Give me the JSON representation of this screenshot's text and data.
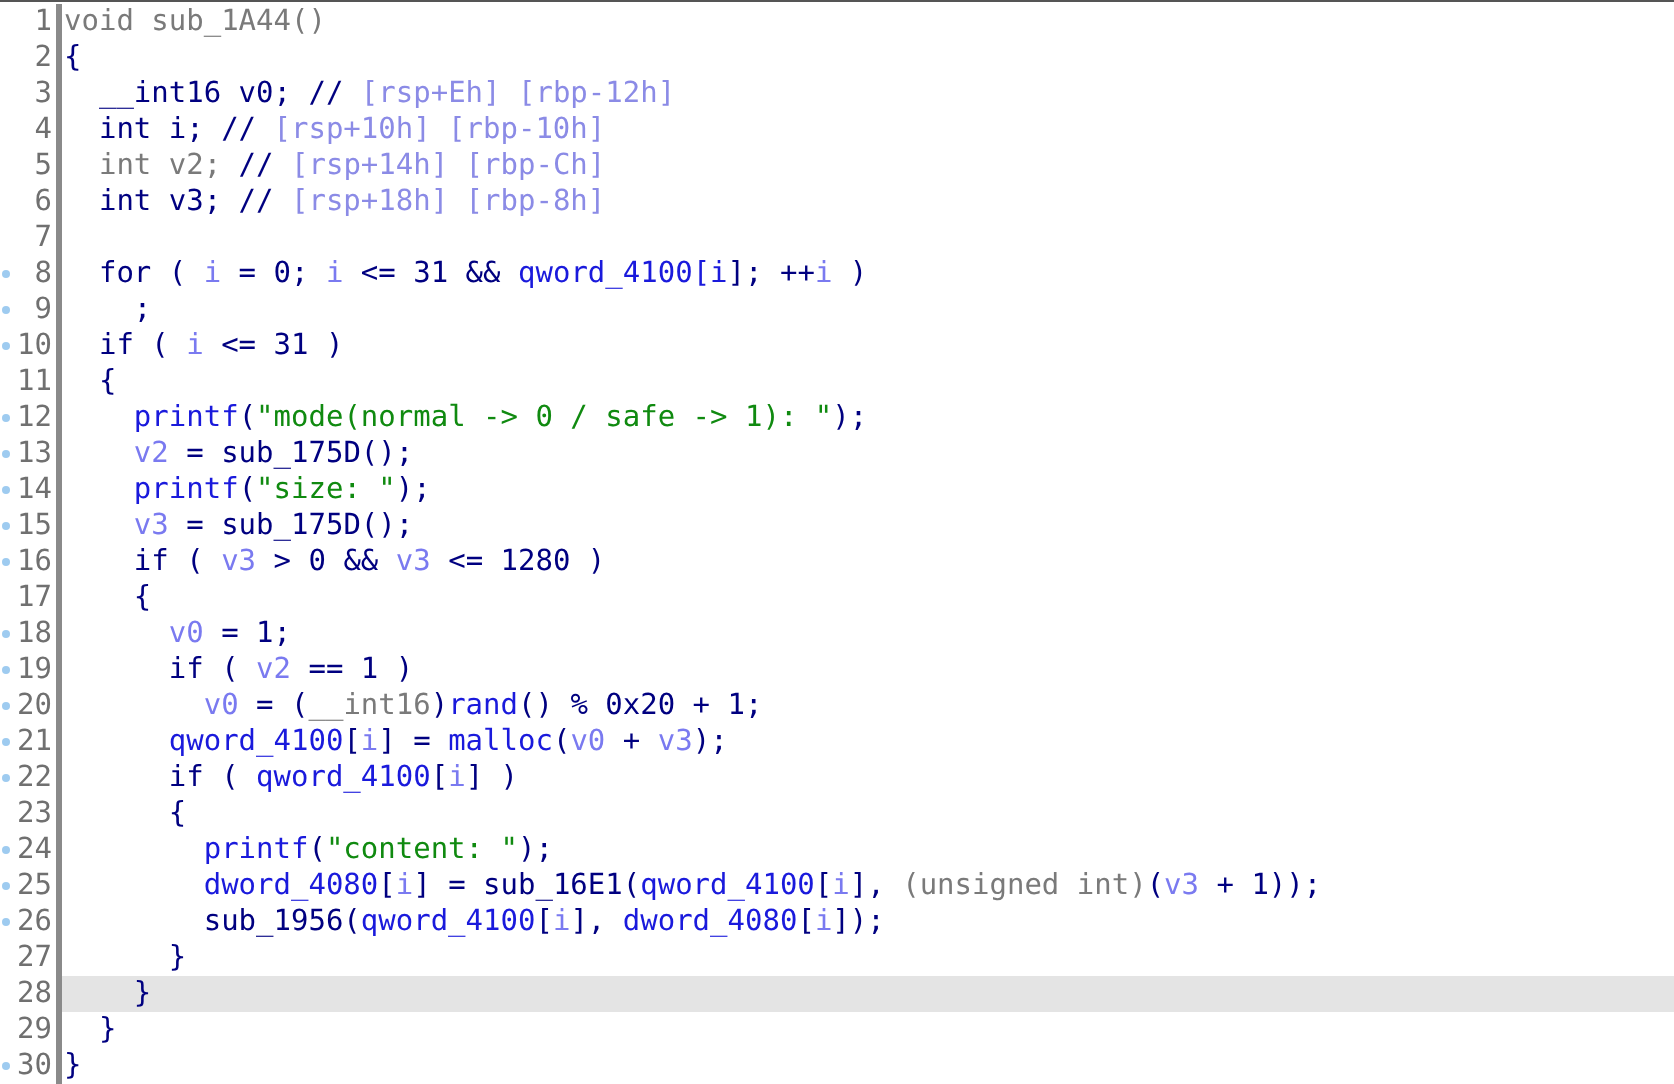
{
  "lines": [
    {
      "number": "1",
      "marker": false,
      "highlighted": false,
      "tokens": [
        {
          "kind": "gray",
          "text": "void sub_1A44()"
        }
      ]
    },
    {
      "number": "2",
      "marker": false,
      "highlighted": false,
      "tokens": [
        {
          "kind": "plain",
          "text": "{"
        }
      ]
    },
    {
      "number": "3",
      "marker": false,
      "highlighted": false,
      "tokens": [
        {
          "kind": "plain",
          "text": "  __int16 v0; //"
        },
        {
          "kind": "comment",
          "text": " [rsp+Eh] [rbp-12h]"
        }
      ]
    },
    {
      "number": "4",
      "marker": false,
      "highlighted": false,
      "tokens": [
        {
          "kind": "plain",
          "text": "  int i; //"
        },
        {
          "kind": "comment",
          "text": " [rsp+10h] [rbp-10h]"
        }
      ]
    },
    {
      "number": "5",
      "marker": false,
      "highlighted": false,
      "tokens": [
        {
          "kind": "gray",
          "text": "  int v2;"
        },
        {
          "kind": "plain",
          "text": " //"
        },
        {
          "kind": "comment",
          "text": " [rsp+14h] [rbp-Ch]"
        }
      ]
    },
    {
      "number": "6",
      "marker": false,
      "highlighted": false,
      "tokens": [
        {
          "kind": "plain",
          "text": "  int v3; //"
        },
        {
          "kind": "comment",
          "text": " [rsp+18h] [rbp-8h]"
        }
      ]
    },
    {
      "number": "7",
      "marker": false,
      "highlighted": false
    },
    {
      "number": "8",
      "marker": true,
      "highlighted": false,
      "tokens": [
        {
          "kind": "plain",
          "text": "  for ( "
        },
        {
          "kind": "var",
          "text": "i"
        },
        {
          "kind": "plain",
          "text": " = 0; "
        },
        {
          "kind": "var",
          "text": "i"
        },
        {
          "kind": "plain",
          "text": " <= 31 && "
        },
        {
          "kind": "global",
          "text": "qword_4100[i"
        },
        {
          "kind": "plain",
          "text": "]; ++"
        },
        {
          "kind": "var",
          "text": "i"
        },
        {
          "kind": "plain",
          "text": " )"
        }
      ]
    },
    {
      "number": "9",
      "marker": true,
      "highlighted": false,
      "tokens": [
        {
          "kind": "plain",
          "text": "    ;"
        }
      ]
    },
    {
      "number": "10",
      "marker": true,
      "highlighted": false,
      "tokens": [
        {
          "kind": "plain",
          "text": "  if ( "
        },
        {
          "kind": "var",
          "text": "i"
        },
        {
          "kind": "plain",
          "text": " <= 31 )"
        }
      ]
    },
    {
      "number": "11",
      "marker": false,
      "highlighted": false,
      "tokens": [
        {
          "kind": "plain",
          "text": "  {"
        }
      ]
    },
    {
      "number": "12",
      "marker": true,
      "highlighted": false,
      "tokens": [
        {
          "kind": "global",
          "text": "    printf"
        },
        {
          "kind": "plain",
          "text": "("
        },
        {
          "kind": "string",
          "text": "\"mode(normal -> 0 / safe -> 1): \""
        },
        {
          "kind": "plain",
          "text": ");"
        }
      ]
    },
    {
      "number": "13",
      "marker": true,
      "highlighted": false,
      "tokens": [
        {
          "kind": "var",
          "text": "    v2"
        },
        {
          "kind": "plain",
          "text": " = sub_175D();"
        }
      ]
    },
    {
      "number": "14",
      "marker": true,
      "highlighted": false,
      "tokens": [
        {
          "kind": "global",
          "text": "    printf"
        },
        {
          "kind": "plain",
          "text": "("
        },
        {
          "kind": "string",
          "text": "\"size: \""
        },
        {
          "kind": "plain",
          "text": ");"
        }
      ]
    },
    {
      "number": "15",
      "marker": true,
      "highlighted": false,
      "tokens": [
        {
          "kind": "var",
          "text": "    v3"
        },
        {
          "kind": "plain",
          "text": " = sub_175D();"
        }
      ]
    },
    {
      "number": "16",
      "marker": true,
      "highlighted": false,
      "tokens": [
        {
          "kind": "plain",
          "text": "    if ( "
        },
        {
          "kind": "var",
          "text": "v3"
        },
        {
          "kind": "plain",
          "text": " > 0 && "
        },
        {
          "kind": "var",
          "text": "v3"
        },
        {
          "kind": "plain",
          "text": " <= 1280 )"
        }
      ]
    },
    {
      "number": "17",
      "marker": false,
      "highlighted": false,
      "tokens": [
        {
          "kind": "plain",
          "text": "    {"
        }
      ]
    },
    {
      "number": "18",
      "marker": true,
      "highlighted": false,
      "tokens": [
        {
          "kind": "var",
          "text": "      v0"
        },
        {
          "kind": "plain",
          "text": " = 1;"
        }
      ]
    },
    {
      "number": "19",
      "marker": true,
      "highlighted": false,
      "tokens": [
        {
          "kind": "plain",
          "text": "      if ( "
        },
        {
          "kind": "var",
          "text": "v2"
        },
        {
          "kind": "plain",
          "text": " == 1 )"
        }
      ]
    },
    {
      "number": "20",
      "marker": true,
      "highlighted": false,
      "tokens": [
        {
          "kind": "var",
          "text": "        v0"
        },
        {
          "kind": "plain",
          "text": " = ("
        },
        {
          "kind": "gray",
          "text": "__int16"
        },
        {
          "kind": "plain",
          "text": ")"
        },
        {
          "kind": "global",
          "text": "rand"
        },
        {
          "kind": "plain",
          "text": "() % 0x20 + 1;"
        }
      ]
    },
    {
      "number": "21",
      "marker": true,
      "highlighted": false,
      "tokens": [
        {
          "kind": "global",
          "text": "      qword_4100"
        },
        {
          "kind": "plain",
          "text": "["
        },
        {
          "kind": "var",
          "text": "i"
        },
        {
          "kind": "plain",
          "text": "] = "
        },
        {
          "kind": "global",
          "text": "malloc"
        },
        {
          "kind": "plain",
          "text": "("
        },
        {
          "kind": "var",
          "text": "v0"
        },
        {
          "kind": "plain",
          "text": " + "
        },
        {
          "kind": "var",
          "text": "v3"
        },
        {
          "kind": "plain",
          "text": ");"
        }
      ]
    },
    {
      "number": "22",
      "marker": true,
      "highlighted": false,
      "tokens": [
        {
          "kind": "plain",
          "text": "      if ( "
        },
        {
          "kind": "global",
          "text": "qword_4100"
        },
        {
          "kind": "plain",
          "text": "["
        },
        {
          "kind": "var",
          "text": "i"
        },
        {
          "kind": "plain",
          "text": "] )"
        }
      ]
    },
    {
      "number": "23",
      "marker": false,
      "highlighted": false,
      "tokens": [
        {
          "kind": "plain",
          "text": "      {"
        }
      ]
    },
    {
      "number": "24",
      "marker": true,
      "highlighted": false,
      "tokens": [
        {
          "kind": "global",
          "text": "        printf"
        },
        {
          "kind": "plain",
          "text": "("
        },
        {
          "kind": "string",
          "text": "\"content: \""
        },
        {
          "kind": "plain",
          "text": ");"
        }
      ]
    },
    {
      "number": "25",
      "marker": true,
      "highlighted": false,
      "tokens": [
        {
          "kind": "global",
          "text": "        dword_4080"
        },
        {
          "kind": "plain",
          "text": "["
        },
        {
          "kind": "var",
          "text": "i"
        },
        {
          "kind": "plain",
          "text": "] = sub_16E1("
        },
        {
          "kind": "global",
          "text": "qword_4100"
        },
        {
          "kind": "plain",
          "text": "["
        },
        {
          "kind": "var",
          "text": "i"
        },
        {
          "kind": "plain",
          "text": "], "
        },
        {
          "kind": "gray",
          "text": "(unsigned int)"
        },
        {
          "kind": "plain",
          "text": "("
        },
        {
          "kind": "var",
          "text": "v3"
        },
        {
          "kind": "plain",
          "text": " + 1));"
        }
      ]
    },
    {
      "number": "26",
      "marker": true,
      "highlighted": false,
      "tokens": [
        {
          "kind": "plain",
          "text": "        sub_1956("
        },
        {
          "kind": "global",
          "text": "qword_4100"
        },
        {
          "kind": "plain",
          "text": "["
        },
        {
          "kind": "var",
          "text": "i"
        },
        {
          "kind": "plain",
          "text": "], "
        },
        {
          "kind": "global",
          "text": "dword_4080"
        },
        {
          "kind": "plain",
          "text": "["
        },
        {
          "kind": "var",
          "text": "i"
        },
        {
          "kind": "plain",
          "text": "]);"
        }
      ]
    },
    {
      "number": "27",
      "marker": false,
      "highlighted": false,
      "tokens": [
        {
          "kind": "plain",
          "text": "      }"
        }
      ]
    },
    {
      "number": "28",
      "marker": false,
      "highlighted": true,
      "tokens": [
        {
          "kind": "plain",
          "text": "    }"
        }
      ]
    },
    {
      "number": "29",
      "marker": false,
      "highlighted": false,
      "tokens": [
        {
          "kind": "plain",
          "text": "  }"
        }
      ]
    },
    {
      "number": "30",
      "marker": true,
      "highlighted": false,
      "tokens": [
        {
          "kind": "plain",
          "text": "}"
        }
      ]
    }
  ]
}
